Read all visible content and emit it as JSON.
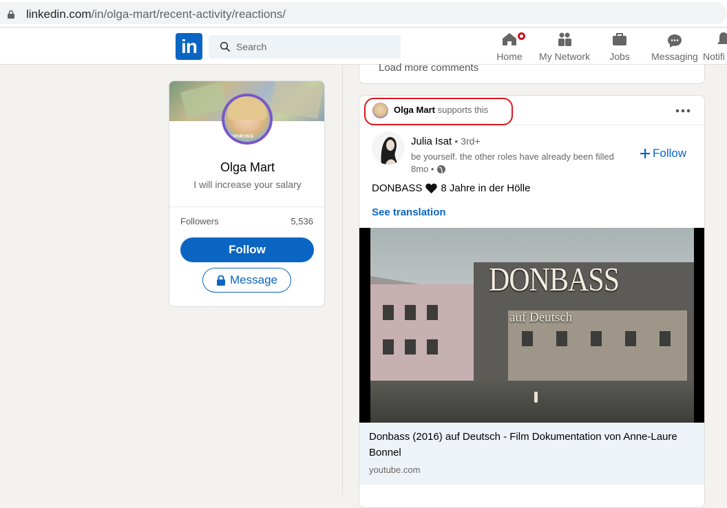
{
  "browser": {
    "url_domain": "linkedin.com",
    "url_path": "/in/olga-mart/recent-activity/reactions/"
  },
  "nav": {
    "logo_text": "in",
    "search_placeholder": "Search",
    "items": [
      {
        "label": "Home",
        "icon": "home-icon"
      },
      {
        "label": "My Network",
        "icon": "my-network-icon"
      },
      {
        "label": "Jobs",
        "icon": "jobs-icon"
      },
      {
        "label": "Messaging",
        "icon": "messaging-icon"
      },
      {
        "label": "Notifi",
        "icon": "notifications-icon"
      }
    ]
  },
  "profile": {
    "name": "Olga Mart",
    "headline": "I will increase your salary",
    "avatar_badge": "#HIRING",
    "followers_label": "Followers",
    "followers_count": "5,536",
    "follow_label": "Follow",
    "message_label": "Message"
  },
  "previous_post": {
    "load_more": "Load more comments"
  },
  "post": {
    "reactor_name": "Olga Mart",
    "reaction_text": "supports this",
    "author_name": "Julia Isat",
    "author_degree": "• 3rd+",
    "author_desc": "be yourself. the other roles have already been filled",
    "author_time": "8mo •",
    "follow_label": "Follow",
    "text_before": "DONBASS",
    "text_after": "8 Jahre in der Hölle",
    "see_translation": "See translation",
    "video_title": "DONBASS",
    "video_subtitle": "auf Deutsch",
    "link_title": "Donbass (2016) auf Deutsch - Film Dokumentation von Anne-Laure Bonnel",
    "link_domain": "youtube.com"
  },
  "colors": {
    "linkedin_blue": "#0a66c2",
    "highlight_red": "#e0151c",
    "page_bg": "#f3f2ef"
  }
}
